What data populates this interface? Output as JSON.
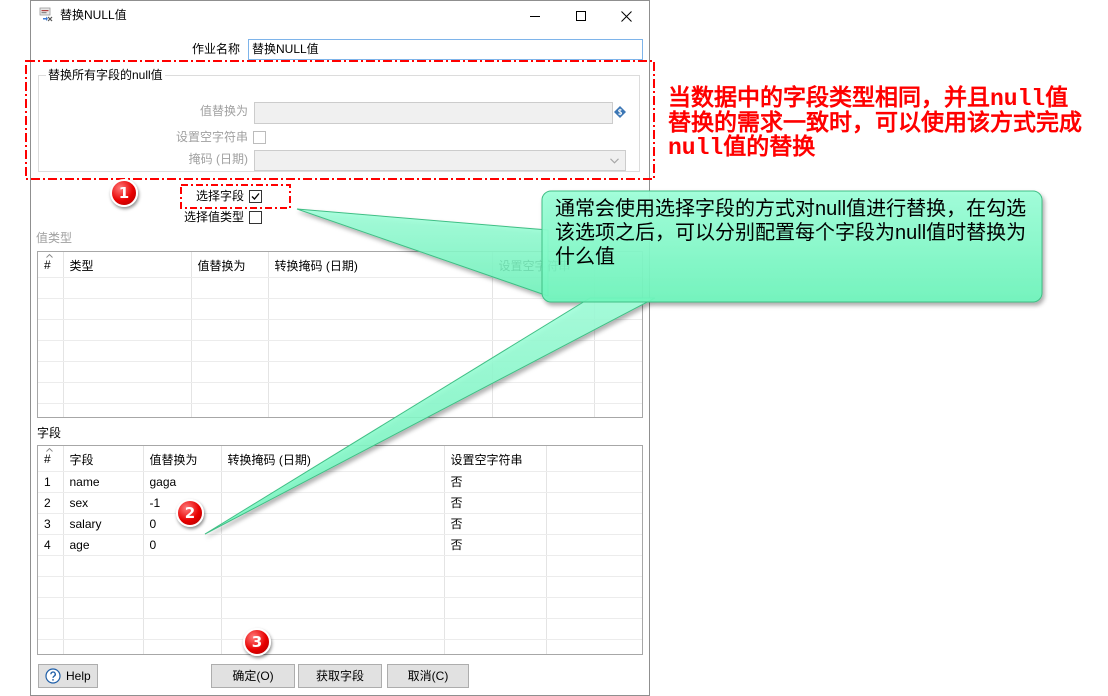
{
  "window": {
    "title": "替换NULL值",
    "icons": {
      "app": "null-replace-step-icon",
      "minimize": "minimize-icon",
      "maximize": "maximize-icon",
      "close": "close-icon"
    }
  },
  "form": {
    "job_name": {
      "label": "作业名称",
      "value": "替换NULL值"
    },
    "replace_all": {
      "title": "替换所有字段的null值",
      "replace_with": {
        "label": "值替换为",
        "value": "",
        "enabled": false,
        "icon": "variable-icon"
      },
      "set_empty_string": {
        "label": "设置空字符串",
        "checked": false,
        "enabled": false
      },
      "mask": {
        "label": "掩码 (日期)",
        "value": "",
        "enabled": false
      }
    },
    "select_fields": {
      "label": "选择字段",
      "checked": true
    },
    "select_value_types": {
      "label": "选择值类型",
      "checked": false
    }
  },
  "value_types_table": {
    "label": "值类型",
    "columns": [
      "#",
      "类型",
      "值替换为",
      "转换掩码 (日期)",
      "设置空字符串"
    ],
    "rows": []
  },
  "fields_table": {
    "label": "字段",
    "columns": [
      "#",
      "字段",
      "值替换为",
      "转换掩码 (日期)",
      "设置空字符串"
    ],
    "rows": [
      {
        "num": "1",
        "field": "name",
        "replace_with": "gaga",
        "mask": "",
        "set_empty": "否"
      },
      {
        "num": "2",
        "field": "sex",
        "replace_with": "-1",
        "mask": "",
        "set_empty": "否"
      },
      {
        "num": "3",
        "field": "salary",
        "replace_with": "0",
        "mask": "",
        "set_empty": "否"
      },
      {
        "num": "4",
        "field": "age",
        "replace_with": "0",
        "mask": "",
        "set_empty": "否"
      }
    ]
  },
  "buttons": {
    "help": "Help",
    "ok": "确定(O)",
    "get_fields": "获取字段",
    "cancel": "取消(C)",
    "help_icon": "help-icon"
  },
  "annotations": {
    "markers": [
      "1",
      "2",
      "3"
    ],
    "red_note": {
      "color": "#ff0000",
      "lines": [
        "当数据中的字段类型相同，并且null值",
        "替换的需求一致时，可以使用该方式完成",
        "null值的替换"
      ]
    },
    "callout": {
      "fill": "#86fccb",
      "lines": [
        "通常会使用选择字段的方式对null值进行替换，在勾选",
        "该选项之后，可以分别配置每个字段为null值时替换为",
        "什么值"
      ]
    }
  },
  "colors": {
    "focus_border": "#7eb4ea",
    "disabled_text": "#a0a0a0",
    "button_face": "#e1e1e1"
  }
}
